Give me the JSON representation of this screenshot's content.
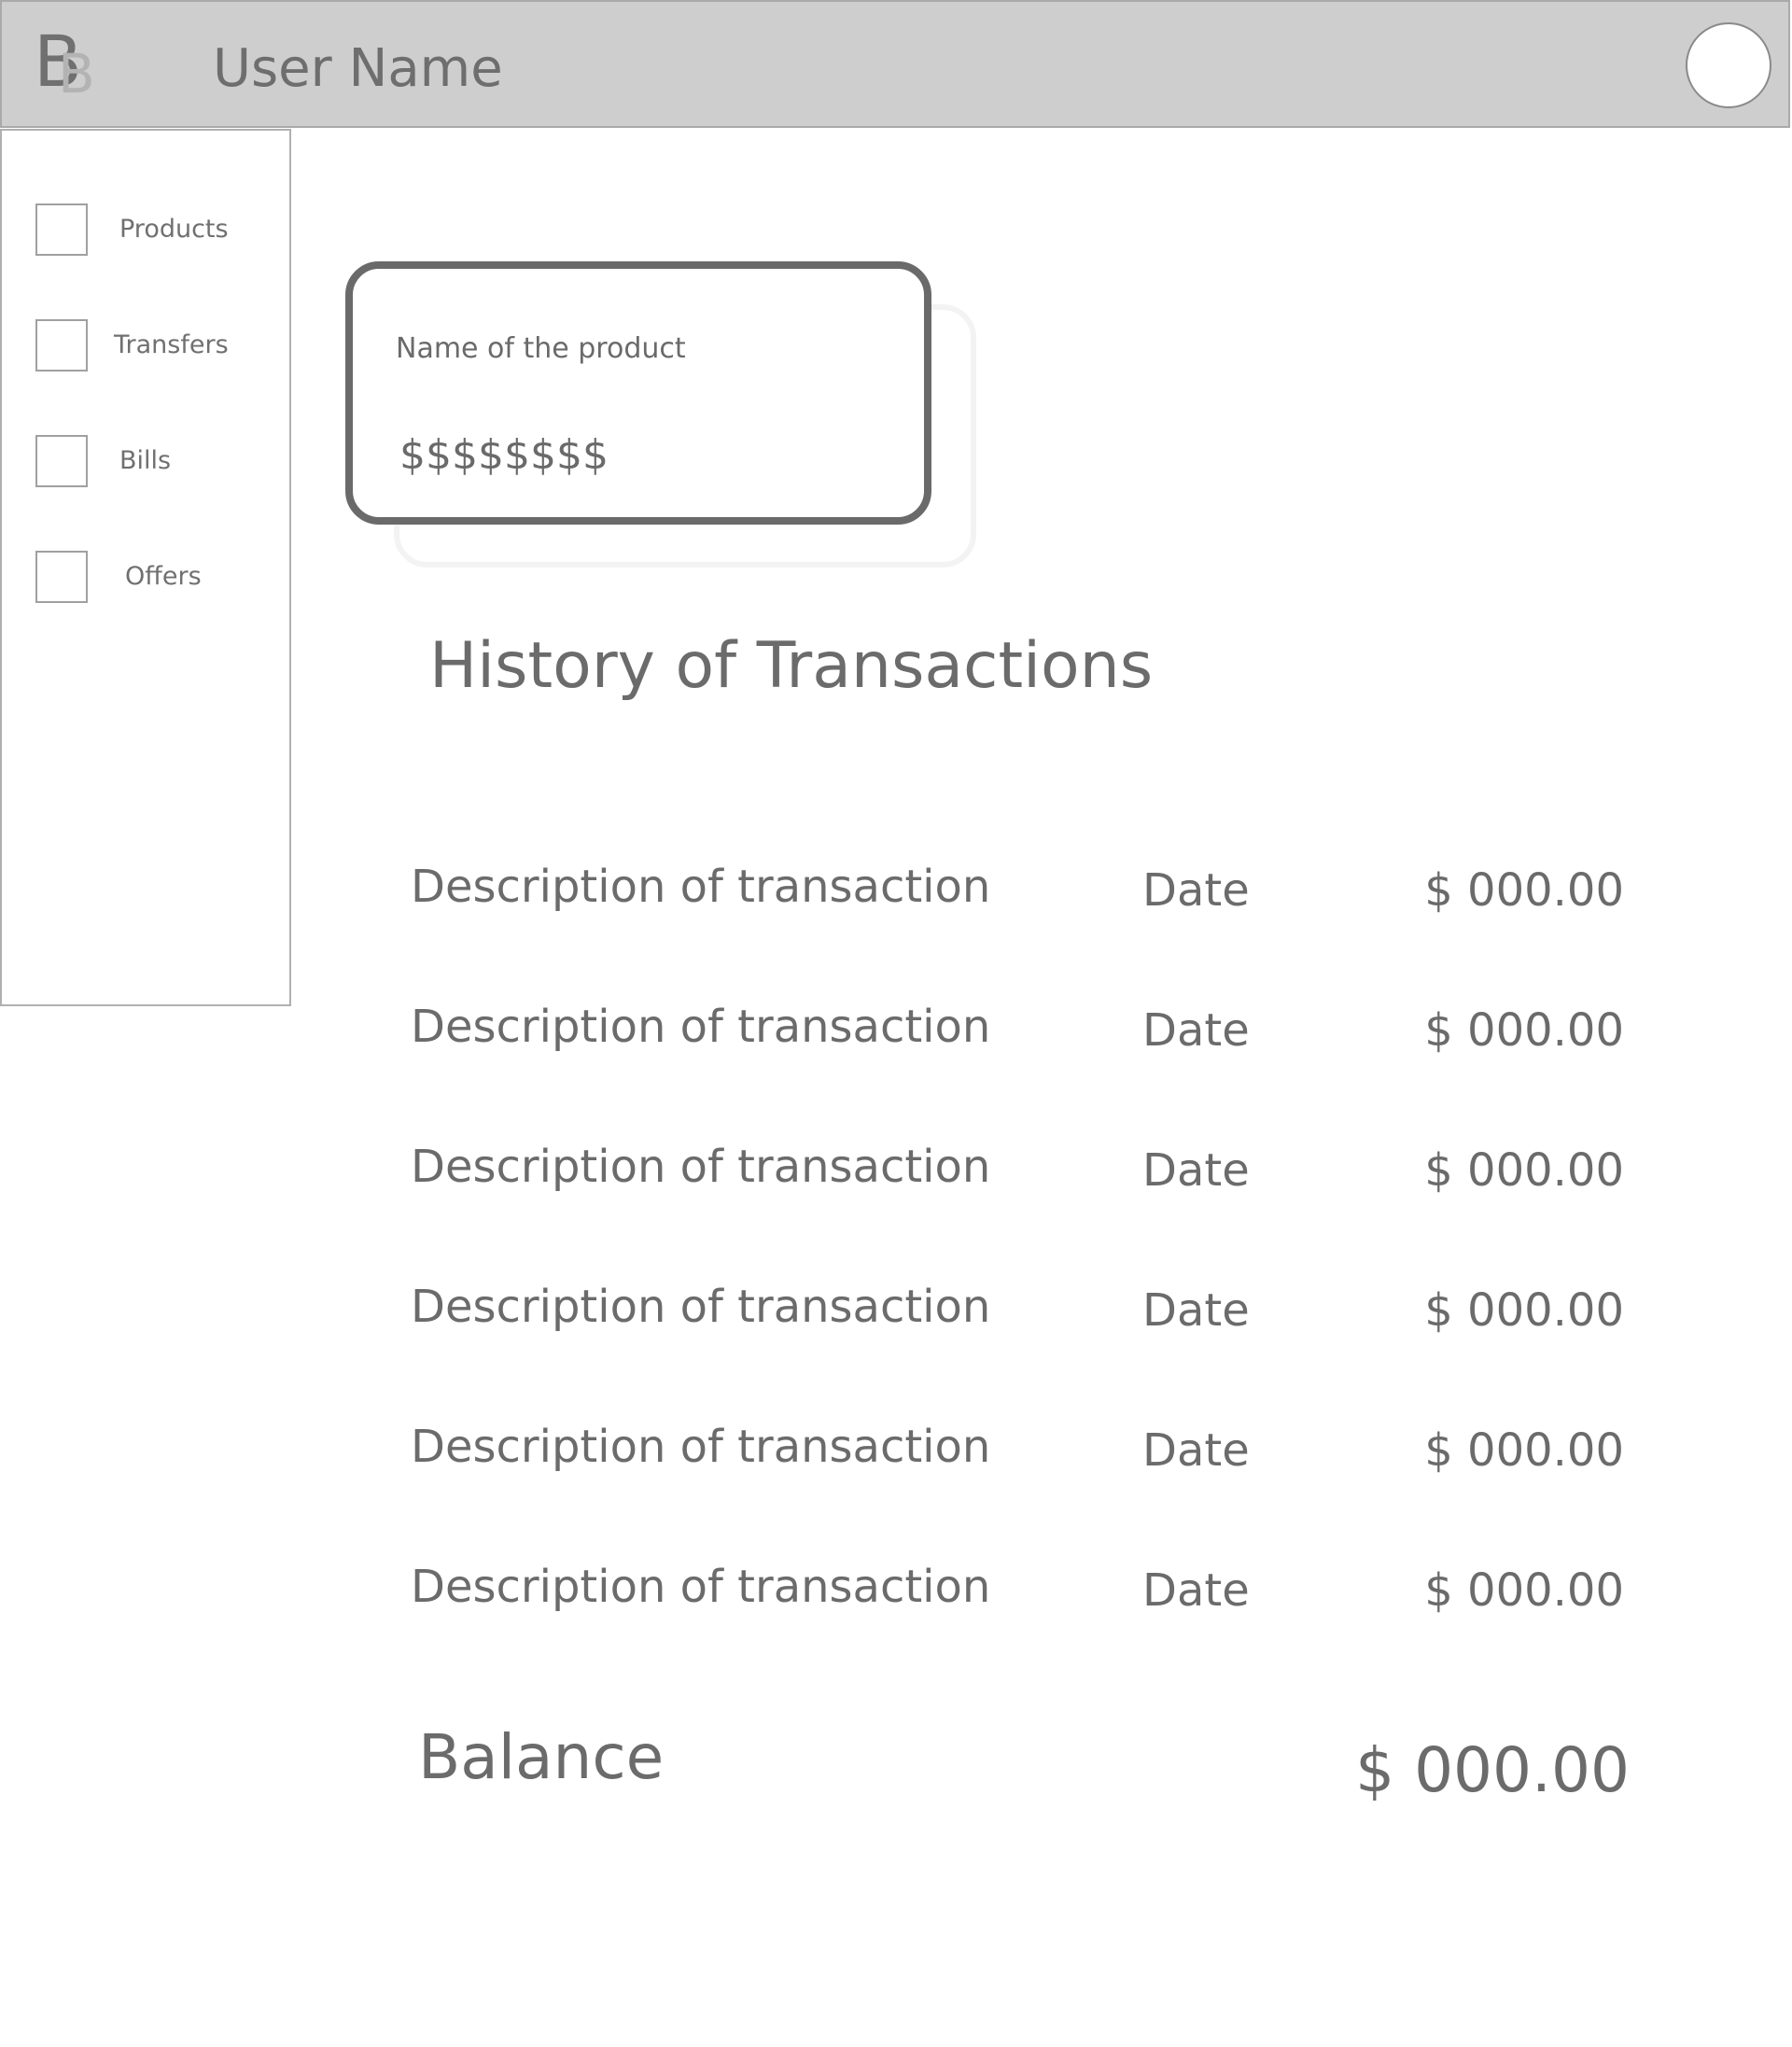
{
  "header": {
    "logo_letter_primary": "B",
    "logo_letter_secondary": "B",
    "user_name": "User Name"
  },
  "sidebar": {
    "items": [
      {
        "label": "Products"
      },
      {
        "label": "Transfers"
      },
      {
        "label": "Bills"
      },
      {
        "label": "Offers"
      }
    ]
  },
  "product_card": {
    "title": "Name of the product",
    "amount": "$$$$$$$$"
  },
  "history": {
    "title": "History of Transactions",
    "rows": [
      {
        "description": "Description of transaction",
        "date": "Date",
        "amount": "$ 000.00"
      },
      {
        "description": "Description of transaction",
        "date": "Date",
        "amount": "$ 000.00"
      },
      {
        "description": "Description of transaction",
        "date": "Date",
        "amount": "$ 000.00"
      },
      {
        "description": "Description of transaction",
        "date": "Date",
        "amount": "$ 000.00"
      },
      {
        "description": "Description of transaction",
        "date": "Date",
        "amount": "$ 000.00"
      },
      {
        "description": "Description of transaction",
        "date": "Date",
        "amount": "$ 000.00"
      }
    ]
  },
  "balance": {
    "label": "Balance",
    "amount": "$ 000.00"
  }
}
